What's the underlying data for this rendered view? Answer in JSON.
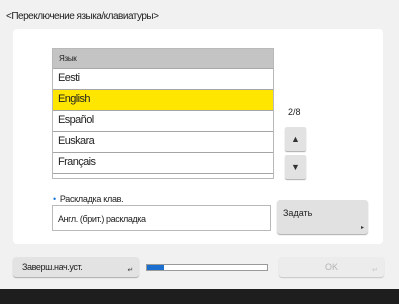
{
  "title": "<Переключение языка/клавиатуры>",
  "language_list": {
    "header": "Язык",
    "items": [
      {
        "label": "Eesti",
        "selected": false
      },
      {
        "label": "English",
        "selected": true
      },
      {
        "label": "Español",
        "selected": false
      },
      {
        "label": "Euskara",
        "selected": false
      },
      {
        "label": "Français",
        "selected": false
      }
    ]
  },
  "pagination": {
    "text": "2/8",
    "up_icon": "triangle-up-icon",
    "down_icon": "triangle-down-icon"
  },
  "keyboard_layout": {
    "label": "Раскладка клав.",
    "value": "Англ. (брит.) раскладка",
    "set_button_label": "Задать"
  },
  "footer": {
    "check_button_label": "Заверш.нач.уст.",
    "progress_fraction": 0.14,
    "ok_label": "OK",
    "ok_enabled": false
  },
  "colors": {
    "selection": "#ffe600",
    "bullet": "#1d7ad8",
    "progress": "#1a6fcf"
  }
}
